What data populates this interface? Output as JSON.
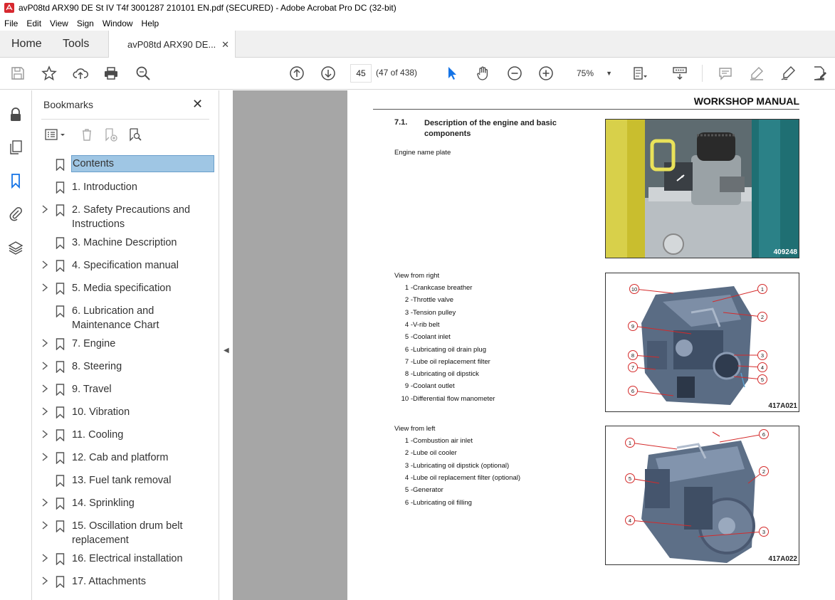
{
  "window": {
    "title": "avP08td ARX90 DE St IV T4f 3001287 210101 EN.pdf (SECURED) - Adobe Acrobat Pro DC (32-bit)"
  },
  "menu": [
    "File",
    "Edit",
    "View",
    "Sign",
    "Window",
    "Help"
  ],
  "tabs": {
    "home": "Home",
    "tools": "Tools",
    "document": "avP08td ARX90 DE..."
  },
  "toolbar": {
    "page_number": "45",
    "page_count": "(47 of 438)",
    "zoom": "75%"
  },
  "bookmarks": {
    "title": "Bookmarks",
    "items": [
      {
        "label": "Contents",
        "expandable": false,
        "selected": true
      },
      {
        "label": "1. Introduction",
        "expandable": false
      },
      {
        "label": "2. Safety Precautions and Instructions",
        "expandable": true
      },
      {
        "label": "3. Machine Description",
        "expandable": false
      },
      {
        "label": "4. Specification manual",
        "expandable": true
      },
      {
        "label": "5. Media specification",
        "expandable": true
      },
      {
        "label": "6. Lubrication and Maintenance Chart",
        "expandable": false
      },
      {
        "label": "7. Engine",
        "expandable": true
      },
      {
        "label": "8. Steering",
        "expandable": true
      },
      {
        "label": "9. Travel",
        "expandable": true
      },
      {
        "label": "10. Vibration",
        "expandable": true
      },
      {
        "label": "11. Cooling",
        "expandable": true
      },
      {
        "label": "12. Cab and platform",
        "expandable": true
      },
      {
        "label": "13. Fuel tank removal",
        "expandable": false
      },
      {
        "label": "14. Sprinkling",
        "expandable": true
      },
      {
        "label": "15. Oscillation drum belt replacement",
        "expandable": true
      },
      {
        "label": "16. Electrical installation",
        "expandable": true
      },
      {
        "label": "17. Attachments",
        "expandable": true
      }
    ]
  },
  "document": {
    "header": "WORKSHOP MANUAL",
    "section_number": "7.1.",
    "section_title": "Description of the engine and basic components",
    "name_plate_label": "Engine name plate",
    "fig1_code": "409248",
    "right_view": {
      "title": "View from right",
      "items": [
        {
          "n": "1 -",
          "t": "Crankcase breather"
        },
        {
          "n": "2 -",
          "t": "Throttle valve"
        },
        {
          "n": "3 -",
          "t": "Tension pulley"
        },
        {
          "n": "4 -",
          "t": "V-rib belt"
        },
        {
          "n": "5 -",
          "t": "Coolant inlet"
        },
        {
          "n": "6 -",
          "t": "Lubricating oil drain plug"
        },
        {
          "n": "7 -",
          "t": "Lube oil replacement filter"
        },
        {
          "n": "8 -",
          "t": "Lubricating oil dipstick"
        },
        {
          "n": "9 -",
          "t": "Coolant outlet"
        },
        {
          "n": "10 -",
          "t": "Differential flow manometer"
        }
      ],
      "fig_code": "417A021",
      "callouts": [
        "10",
        "1",
        "2",
        "9",
        "3",
        "8",
        "4",
        "7",
        "5",
        "6"
      ]
    },
    "left_view": {
      "title": "View from left",
      "items": [
        {
          "n": "1 -",
          "t": "Combustion air inlet"
        },
        {
          "n": "2 -",
          "t": "Lube oil cooler"
        },
        {
          "n": "3 -",
          "t": "Lubricating oil dipstick (optional)"
        },
        {
          "n": "4 -",
          "t": "Lube oil replacement filter (optional)"
        },
        {
          "n": "5 -",
          "t": "Generator"
        },
        {
          "n": "6 -",
          "t": "Lubricating oil filling"
        }
      ],
      "fig_code": "417A022",
      "callouts": [
        "6",
        "1",
        "5",
        "2",
        "4",
        "3"
      ]
    }
  },
  "colors": {
    "accent_blue": "#1473e6",
    "selection": "#9fc6e4",
    "canvas_gray": "#a6a6a6"
  }
}
